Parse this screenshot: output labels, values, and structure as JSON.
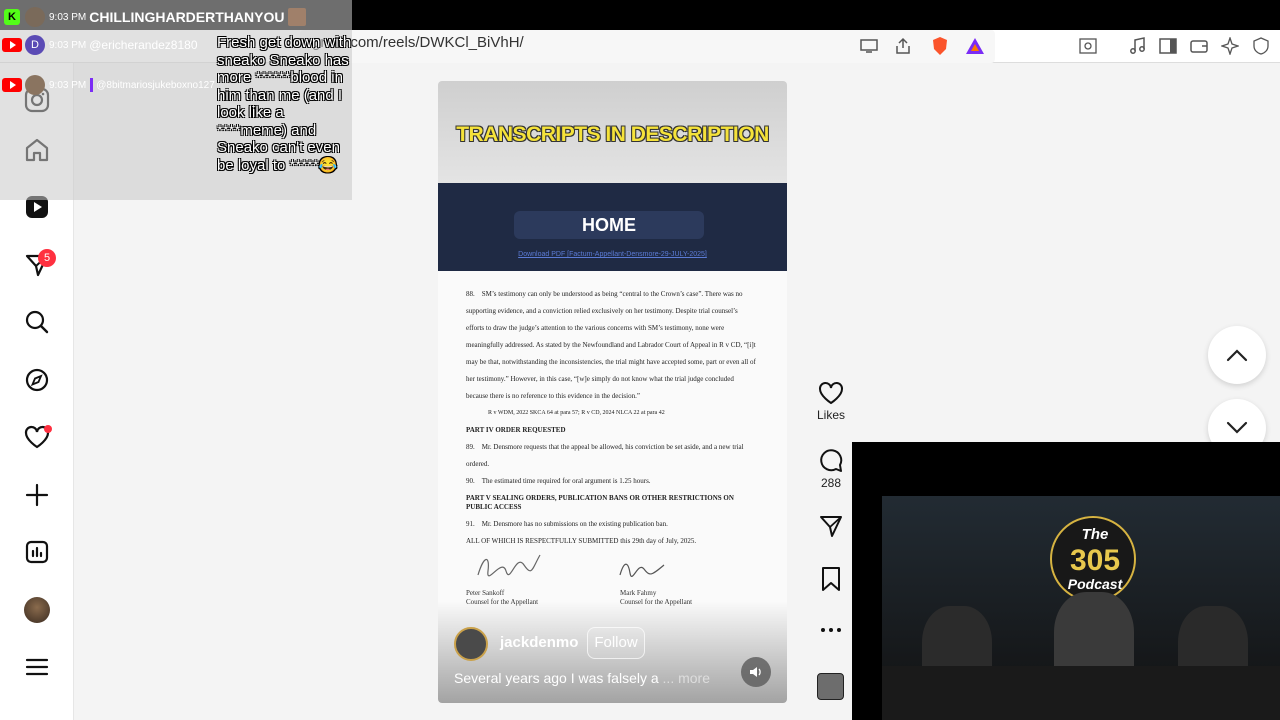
{
  "browser": {
    "url_visible": "gram.com/reels/DWKCl_BiVhH/"
  },
  "chat": {
    "messages": [
      {
        "time": "9:03 PM",
        "user": "CHILLINGHARDERTHANYOU"
      },
      {
        "time": "9:03 PM",
        "user": "@ericherandez8180"
      },
      {
        "time": "9:03 PM",
        "user": "@8bitmariosjukeboxno127"
      }
    ],
    "avatar_letter": "D",
    "message_text": "Fresh get down with sneako Sneako has more ******blood in him than me (and I look like a ****meme) and Sneako can't even be loyal to *****😂"
  },
  "sidebar": {
    "notifications_badge": "5"
  },
  "reel": {
    "banner": "TRANSCRIPTS IN DESCRIPTION",
    "nav_title": "HOME",
    "pdf_link": "Download PDF [Factum-Appellant-Densmore-29-JULY-2025]",
    "document": {
      "para88_num": "88.",
      "para88": "SM’s testimony can only be understood as being “central to the Crown’s case”. There was no supporting evidence, and a conviction relied exclusively on her testimony. Despite trial counsel’s efforts to draw the judge’s attention to the various concerns with SM’s testimony, none were meaningfully addressed. As stated by the Newfoundland and Labrador Court of Appeal in R v CD, “[i]t may be that, notwithstanding the inconsistencies, the trial might have accepted some, part or even all of her testimony.” However, in this case, “[w]e simply do not know what the trial judge concluded because there is no reference to this evidence in the decision.”",
      "citation": "R v WDM, 2022 SKCA 64 at para 57; R v CD, 2024 NLCA 22 at para 42",
      "part4": "PART IV      ORDER REQUESTED",
      "para89_num": "89.",
      "para89": "Mr. Densmore requests that the appeal be allowed, his conviction be set aside, and a new trial ordered.",
      "para90_num": "90.",
      "para90": "The estimated time required for oral argument is 1.25 hours.",
      "part5": "PART V      SEALING ORDERS, PUBLICATION BANS OR OTHER RESTRICTIONS ON PUBLIC ACCESS",
      "para91_num": "91.",
      "para91": "Mr. Densmore has no submissions on the existing publication ban.",
      "closing": "ALL OF WHICH IS RESPECTFULLY SUBMITTED this 29th day of July, 2025.",
      "sig1_name": "Peter Sankoff",
      "sig1_role": "Counsel for the Appellant",
      "sig2_name": "Mark Fahmy",
      "sig2_role": "Counsel for the Appellant"
    },
    "author_handle": "jackdenmo",
    "follow_label": "Follow",
    "caption": "Several years ago I was falsely a",
    "caption_more": "... more"
  },
  "actions": {
    "likes_label": "Likes",
    "comments_count": "288"
  },
  "podcast": {
    "logo_line1": "The",
    "logo_line2": "305",
    "logo_line3": "Podcast"
  }
}
